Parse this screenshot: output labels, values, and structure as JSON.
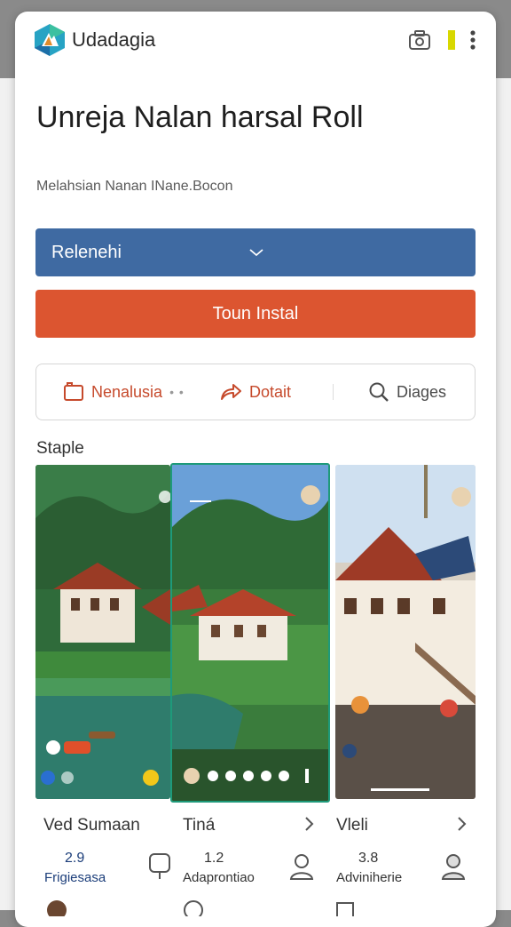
{
  "app": {
    "name": "Udadagia",
    "icons": [
      "logo-icon",
      "camera-icon",
      "flag-icon",
      "more-icon"
    ]
  },
  "page": {
    "title": "Unreja Nalan harsal Roll",
    "subtitle": "Melahsian Nanan INane.Bocon"
  },
  "select": {
    "value": "Relenehi"
  },
  "primary_button": {
    "label": "Toun Instal"
  },
  "actions": [
    {
      "label": "Nenalusia",
      "icon": "bookmark-icon"
    },
    {
      "label": "Dotait",
      "icon": "share-icon"
    },
    {
      "label": "Diages",
      "icon": "search-icon"
    }
  ],
  "section": {
    "title": "Staple"
  },
  "cards": [
    {
      "title": "Ved Sumaan",
      "stat_value": "2.9",
      "stat_label": "Frigiesasa"
    },
    {
      "title": "Tiná",
      "stat_value": "1.2",
      "stat_label": "Adaprontiao"
    },
    {
      "title": "Vleli",
      "stat_value": "3.8",
      "stat_label": "Adviniherie"
    }
  ],
  "colors": {
    "select_bg": "#3f6aa2",
    "primary_bg": "#dc5530",
    "accent_text": "#c64a2c",
    "selected_border": "#1e9a7a"
  }
}
